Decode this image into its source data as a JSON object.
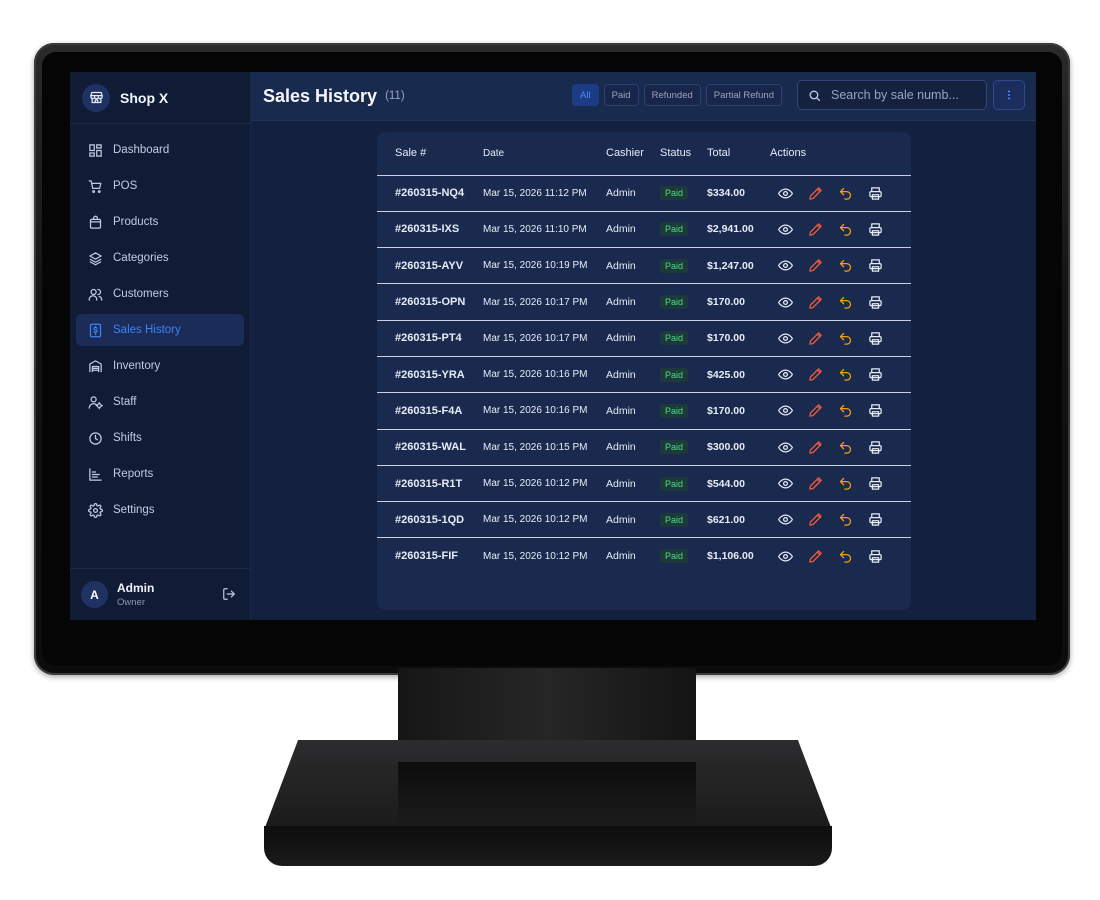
{
  "app": {
    "name": "Shop X"
  },
  "sidebar": {
    "items": [
      {
        "label": "Dashboard",
        "icon": "dashboard-icon"
      },
      {
        "label": "POS",
        "icon": "cart-icon"
      },
      {
        "label": "Products",
        "icon": "bag-icon"
      },
      {
        "label": "Categories",
        "icon": "layers-icon"
      },
      {
        "label": "Customers",
        "icon": "users-icon"
      },
      {
        "label": "Sales History",
        "icon": "receipt-icon",
        "active": true
      },
      {
        "label": "Inventory",
        "icon": "warehouse-icon"
      },
      {
        "label": "Staff",
        "icon": "staff-icon"
      },
      {
        "label": "Shifts",
        "icon": "clock-icon"
      },
      {
        "label": "Reports",
        "icon": "chart-icon"
      },
      {
        "label": "Settings",
        "icon": "gear-icon"
      }
    ],
    "user": {
      "initial": "A",
      "name": "Admin",
      "role": "Owner"
    }
  },
  "header": {
    "title": "Sales History",
    "count": "(11)",
    "filters": [
      "All",
      "Paid",
      "Refunded",
      "Partial Refund"
    ],
    "active_filter": "All",
    "search_placeholder": "Search by sale numb..."
  },
  "table": {
    "columns": [
      "Sale #",
      "Date",
      "Cashier",
      "Status",
      "Total",
      "Actions"
    ],
    "rows": [
      {
        "sale": "#260315-NQ4",
        "date": "Mar 15, 2026 11:12 PM",
        "cashier": "Admin",
        "status": "Paid",
        "total": "$334.00"
      },
      {
        "sale": "#260315-IXS",
        "date": "Mar 15, 2026 11:10 PM",
        "cashier": "Admin",
        "status": "Paid",
        "total": "$2,941.00"
      },
      {
        "sale": "#260315-AYV",
        "date": "Mar 15, 2026 10:19 PM",
        "cashier": "Admin",
        "status": "Paid",
        "total": "$1,247.00"
      },
      {
        "sale": "#260315-OPN",
        "date": "Mar 15, 2026 10:17 PM",
        "cashier": "Admin",
        "status": "Paid",
        "total": "$170.00"
      },
      {
        "sale": "#260315-PT4",
        "date": "Mar 15, 2026 10:17 PM",
        "cashier": "Admin",
        "status": "Paid",
        "total": "$170.00"
      },
      {
        "sale": "#260315-YRA",
        "date": "Mar 15, 2026 10:16 PM",
        "cashier": "Admin",
        "status": "Paid",
        "total": "$425.00"
      },
      {
        "sale": "#260315-F4A",
        "date": "Mar 15, 2026 10:16 PM",
        "cashier": "Admin",
        "status": "Paid",
        "total": "$170.00"
      },
      {
        "sale": "#260315-WAL",
        "date": "Mar 15, 2026 10:15 PM",
        "cashier": "Admin",
        "status": "Paid",
        "total": "$300.00"
      },
      {
        "sale": "#260315-R1T",
        "date": "Mar 15, 2026 10:12 PM",
        "cashier": "Admin",
        "status": "Paid",
        "total": "$544.00"
      },
      {
        "sale": "#260315-1QD",
        "date": "Mar 15, 2026 10:12 PM",
        "cashier": "Admin",
        "status": "Paid",
        "total": "$621.00"
      },
      {
        "sale": "#260315-FIF",
        "date": "Mar 15, 2026 10:12 PM",
        "cashier": "Admin",
        "status": "Paid",
        "total": "$1,106.00"
      }
    ],
    "row_actions": [
      "view-icon",
      "edit-icon",
      "refund-icon",
      "print-icon"
    ]
  },
  "colors": {
    "accent": "#3b82f6",
    "paid": "#4ade80",
    "edit": "#ef5a3c",
    "refund": "#f59e0b",
    "background": "#13203f",
    "sidebar": "#101c36"
  }
}
